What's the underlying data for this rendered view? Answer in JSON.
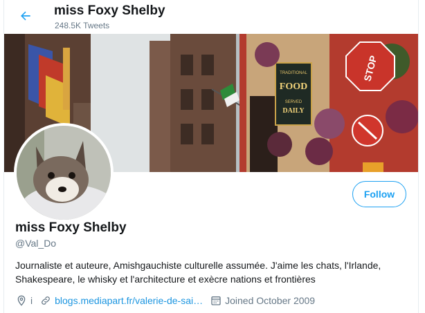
{
  "header": {
    "back_icon": "arrow-left-icon",
    "name": "miss Foxy Shelby",
    "tweet_count": "248.5K Tweets"
  },
  "banner": {
    "sign_food_line1": "TRADITIONAL",
    "sign_food_line2": "FOOD",
    "sign_food_line3": "SERVED",
    "sign_food_line4": "DAILY",
    "stop_sign": "STOP"
  },
  "profile": {
    "follow_label": "Follow",
    "display_name": "miss Foxy Shelby",
    "handle": "@Val_Do",
    "bio": "Journaliste et auteure, Amishgauchiste culturelle assumée. J'aime les chats, l'Irlande, Shakespeare, le whisky et l'architecture et exècre nations et frontières",
    "location": "i",
    "website": "blogs.mediapart.fr/valerie-de-sai…",
    "joined": "Joined October 2009"
  },
  "colors": {
    "accent": "#1da1f2",
    "link": "#1b95e0",
    "secondary_text": "#657786"
  }
}
